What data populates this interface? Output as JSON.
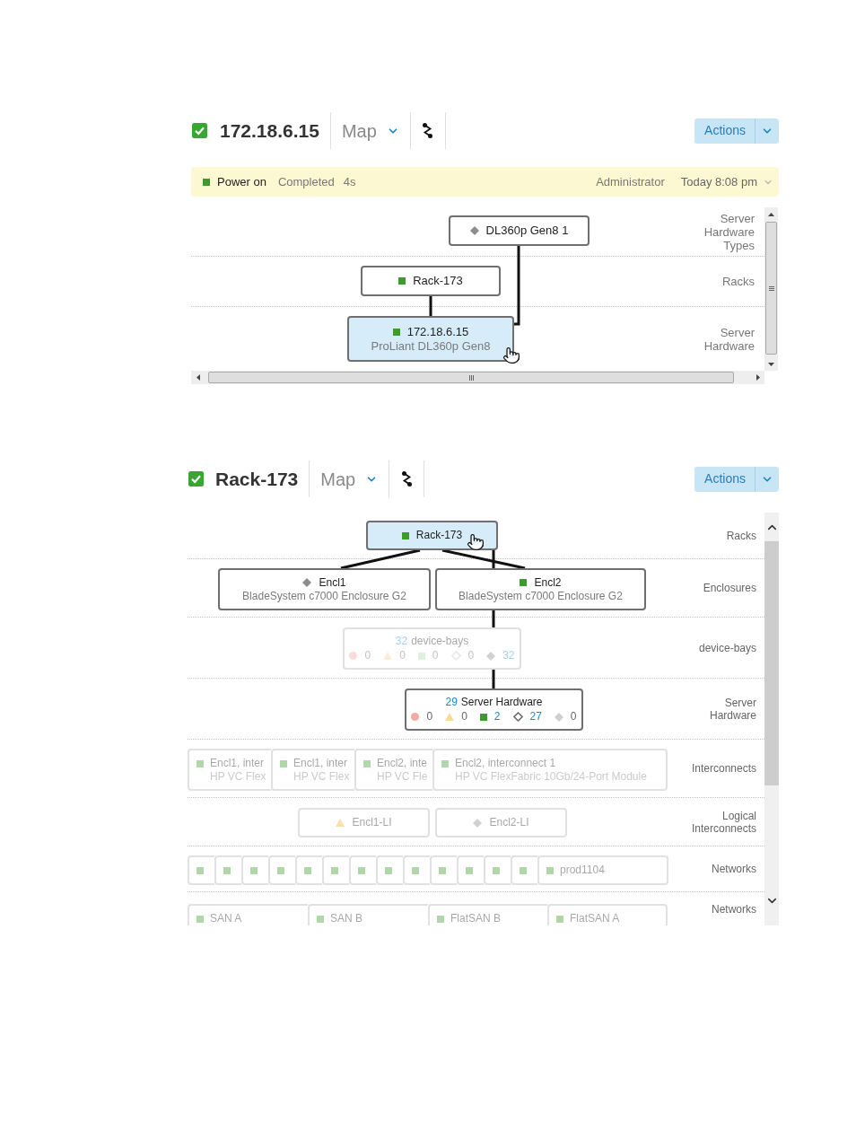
{
  "panels": [
    {
      "title": "172.18.6.15",
      "kind": "ok",
      "view": "Map",
      "actions": "Actions",
      "activity": {
        "kind": "ok",
        "name": "Power on",
        "result": "Completed",
        "duration": "4s",
        "user": "Administrator",
        "time": "Today 8:08 pm"
      },
      "map": {
        "lanes": [
          {
            "label": "Server Hardware Types",
            "kind": "row",
            "nodes": [
              {
                "kind": "unknown",
                "name": "DL360p Gen8 1",
                "selected": false,
                "dimmed": false
              }
            ]
          },
          {
            "label": "Racks",
            "kind": "row",
            "nodes": [
              {
                "kind": "ok",
                "name": "Rack-173",
                "selected": false,
                "dimmed": false
              }
            ]
          },
          {
            "label": "Server Hardware",
            "kind": "row",
            "nodes": [
              {
                "kind": "ok",
                "name": "172.18.6.15",
                "model": "ProLiant DL360p Gen8",
                "selected": true,
                "dimmed": false
              }
            ]
          }
        ]
      }
    },
    {
      "title": "Rack-173",
      "kind": "ok",
      "view": "Map",
      "actions": "Actions",
      "map": {
        "lanes": [
          {
            "label": "Racks",
            "kind": "row",
            "nodes": [
              {
                "kind": "ok",
                "name": "Rack-173",
                "selected": true,
                "dimmed": false
              }
            ]
          },
          {
            "label": "Enclosures",
            "kind": "row",
            "nodes": [
              {
                "kind": "unknown",
                "name": "Encl1",
                "model": "BladeSystem c7000 Enclosure G2",
                "selected": false,
                "dimmed": false
              },
              {
                "kind": "ok",
                "name": "Encl2",
                "model": "BladeSystem c7000 Enclosure G2",
                "selected": false,
                "dimmed": false
              }
            ]
          },
          {
            "label": "device-bays",
            "kind": "row",
            "nodes": [
              {
                "count": "32",
                "name": "device-bays",
                "selected": false,
                "dimmed": true,
                "counts": [
                  {
                    "kind": "critical",
                    "value": "0",
                    "active": false
                  },
                  {
                    "kind": "warning",
                    "value": "0",
                    "active": false
                  },
                  {
                    "kind": "ok",
                    "value": "0",
                    "active": false
                  },
                  {
                    "kind": "unmanaged",
                    "value": "0",
                    "active": false
                  },
                  {
                    "kind": "unknown",
                    "value": "32",
                    "active": true
                  }
                ]
              }
            ]
          },
          {
            "label": "Server Hardware",
            "kind": "row",
            "nodes": [
              {
                "count": "29",
                "name": "Server Hardware",
                "selected": false,
                "dimmed": false,
                "counts": [
                  {
                    "kind": "critical",
                    "value": "0",
                    "active": false
                  },
                  {
                    "kind": "warning",
                    "value": "0",
                    "active": false
                  },
                  {
                    "kind": "ok",
                    "value": "2",
                    "active": true
                  },
                  {
                    "kind": "unmanaged",
                    "value": "27",
                    "active": true
                  },
                  {
                    "kind": "unknown",
                    "value": "0",
                    "active": false
                  }
                ]
              }
            ]
          },
          {
            "label": "Interconnects",
            "kind": "stack",
            "nodes": [
              {
                "kind": "ok",
                "name": "Encl1, inter",
                "model": "HP VC Flex",
                "selected": false,
                "dimmed": true
              },
              {
                "kind": "ok",
                "name": "Encl1, inter",
                "model": "HP VC Flex",
                "selected": false,
                "dimmed": true
              },
              {
                "kind": "ok",
                "name": "Encl2, inte",
                "model": "HP VC Fle",
                "selected": false,
                "dimmed": true
              },
              {
                "kind": "ok",
                "name": "Encl2, interconnect 1",
                "model": "HP VC FlexFabric 10Gb/24-Port Module",
                "selected": false,
                "dimmed": true
              }
            ]
          },
          {
            "label": "Logical Interconnects",
            "kind": "row",
            "nodes": [
              {
                "kind": "warning",
                "name": "Encl1-LI",
                "selected": false,
                "dimmed": true
              },
              {
                "kind": "unknown",
                "name": "Encl2-LI",
                "selected": false,
                "dimmed": true
              }
            ]
          },
          {
            "label": "Networks",
            "kind": "stack",
            "nodes": [
              {
                "kind": "ok",
                "selected": false,
                "dimmed": true
              },
              {
                "kind": "ok",
                "selected": false,
                "dimmed": true
              },
              {
                "kind": "ok",
                "selected": false,
                "dimmed": true
              },
              {
                "kind": "ok",
                "selected": false,
                "dimmed": true
              },
              {
                "kind": "ok",
                "selected": false,
                "dimmed": true
              },
              {
                "kind": "ok",
                "selected": false,
                "dimmed": true
              },
              {
                "kind": "ok",
                "selected": false,
                "dimmed": true
              },
              {
                "kind": "ok",
                "selected": false,
                "dimmed": true
              },
              {
                "kind": "ok",
                "selected": false,
                "dimmed": true
              },
              {
                "kind": "ok",
                "selected": false,
                "dimmed": true
              },
              {
                "kind": "ok",
                "selected": false,
                "dimmed": true
              },
              {
                "kind": "ok",
                "selected": false,
                "dimmed": true
              },
              {
                "kind": "ok",
                "selected": false,
                "dimmed": true
              },
              {
                "kind": "ok",
                "name": "prod1104",
                "selected": false,
                "dimmed": true
              }
            ]
          },
          {
            "label": "Networks",
            "kind": "stack",
            "nodes": [
              {
                "kind": "ok",
                "name": "SAN A",
                "selected": false,
                "dimmed": true
              },
              {
                "kind": "ok",
                "name": "SAN B",
                "selected": false,
                "dimmed": true
              },
              {
                "kind": "ok",
                "name": "FlatSAN B",
                "selected": false,
                "dimmed": true
              },
              {
                "kind": "ok",
                "name": "FlatSAN A",
                "selected": false,
                "dimmed": true
              }
            ]
          }
        ]
      }
    }
  ]
}
